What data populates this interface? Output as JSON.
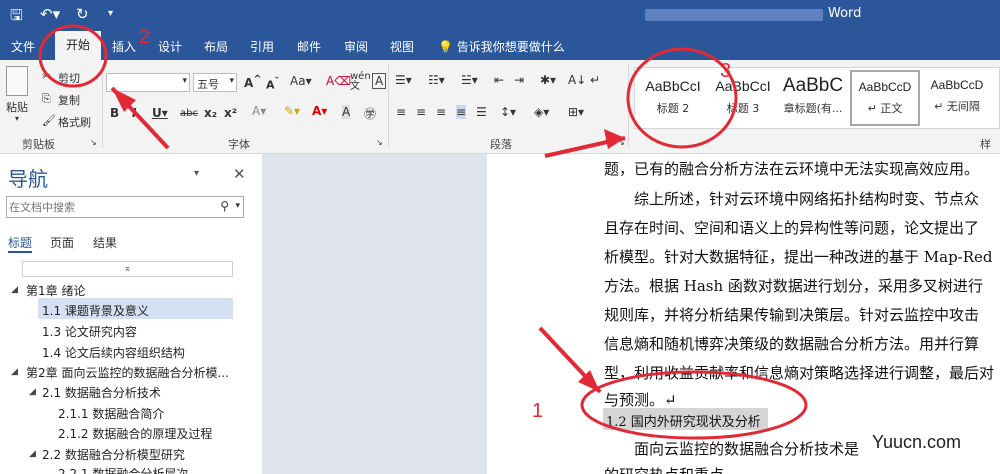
{
  "titlebar": {
    "app_title": "Word"
  },
  "menubar": {
    "tabs": [
      "文件",
      "开始",
      "插入",
      "设计",
      "布局",
      "引用",
      "邮件",
      "审阅",
      "视图"
    ],
    "tell_me": "告诉我你想要做什么"
  },
  "ribbon": {
    "clipboard": {
      "paste": "粘贴",
      "cut": "剪切",
      "copy": "复制",
      "format_painter": "格式刷",
      "group_label": "剪贴板"
    },
    "font": {
      "size": "五号",
      "group_label": "字体"
    },
    "paragraph": {
      "group_label": "段落"
    },
    "styles": {
      "group_label": "样式",
      "items": [
        {
          "preview": "AaBbCcI",
          "name": "标题 2"
        },
        {
          "preview": "AaBbCcI",
          "name": "标题 3"
        },
        {
          "preview": "AaBbC",
          "name": "章标题(有..."
        },
        {
          "preview": "AaBbCcD",
          "name": "↵ 正文"
        },
        {
          "preview": "AaBbCcD",
          "name": "↵ 无间隔"
        }
      ]
    }
  },
  "nav": {
    "title": "导航",
    "search_placeholder": "在文档中搜索",
    "tabs": [
      "标题",
      "页面",
      "结果"
    ],
    "items": [
      {
        "label": "第1章 绪论"
      },
      {
        "label": "1.1 课题背景及意义"
      },
      {
        "label": "1.3 论文研究内容"
      },
      {
        "label": "1.4 论文后续内容组织结构"
      },
      {
        "label": "第2章 面向云监控的数据融合分析模..."
      },
      {
        "label": "2.1 数据融合分析技术"
      },
      {
        "label": "2.1.1 数据融合简介"
      },
      {
        "label": "2.1.2 数据融合的原理及过程"
      },
      {
        "label": "2.2 数据融合分析模型研究"
      },
      {
        "label": "2.2.1 数据融合分析层次"
      }
    ]
  },
  "document": {
    "lines": [
      "题，已有的融合分析方法在云环境中无法实现高效应用。",
      "综上所述，针对云环境中网络拓扑结构时变、节点众",
      "且存在时间、空间和语义上的异构性等问题，论文提出了",
      "析模型。针对大数据特征，提出一种改进的基于 Map-Red",
      "方法。根据 Hash 函数对数据进行划分，采用多叉树进行",
      "规则库，并将分析结果传输到决策层。针对云监控中攻击",
      "信息熵和随机博弈决策级的数据融合分析方法。用并行算",
      "型，利用收益贡献率和信息熵对策略选择进行调整，最后对",
      "与预测。↵",
      "1.2  国内外研究现状及分析",
      "面向云监控的数据融合分析技术是",
      "的研究热点和重点。"
    ]
  },
  "annotations": [
    "1",
    "2",
    "3"
  ],
  "watermark": "Yuucn.com",
  "colors": {
    "word_blue": "#2b579a",
    "annotation_red": "#e12a36",
    "nav_selected": "#d5e1f2"
  }
}
